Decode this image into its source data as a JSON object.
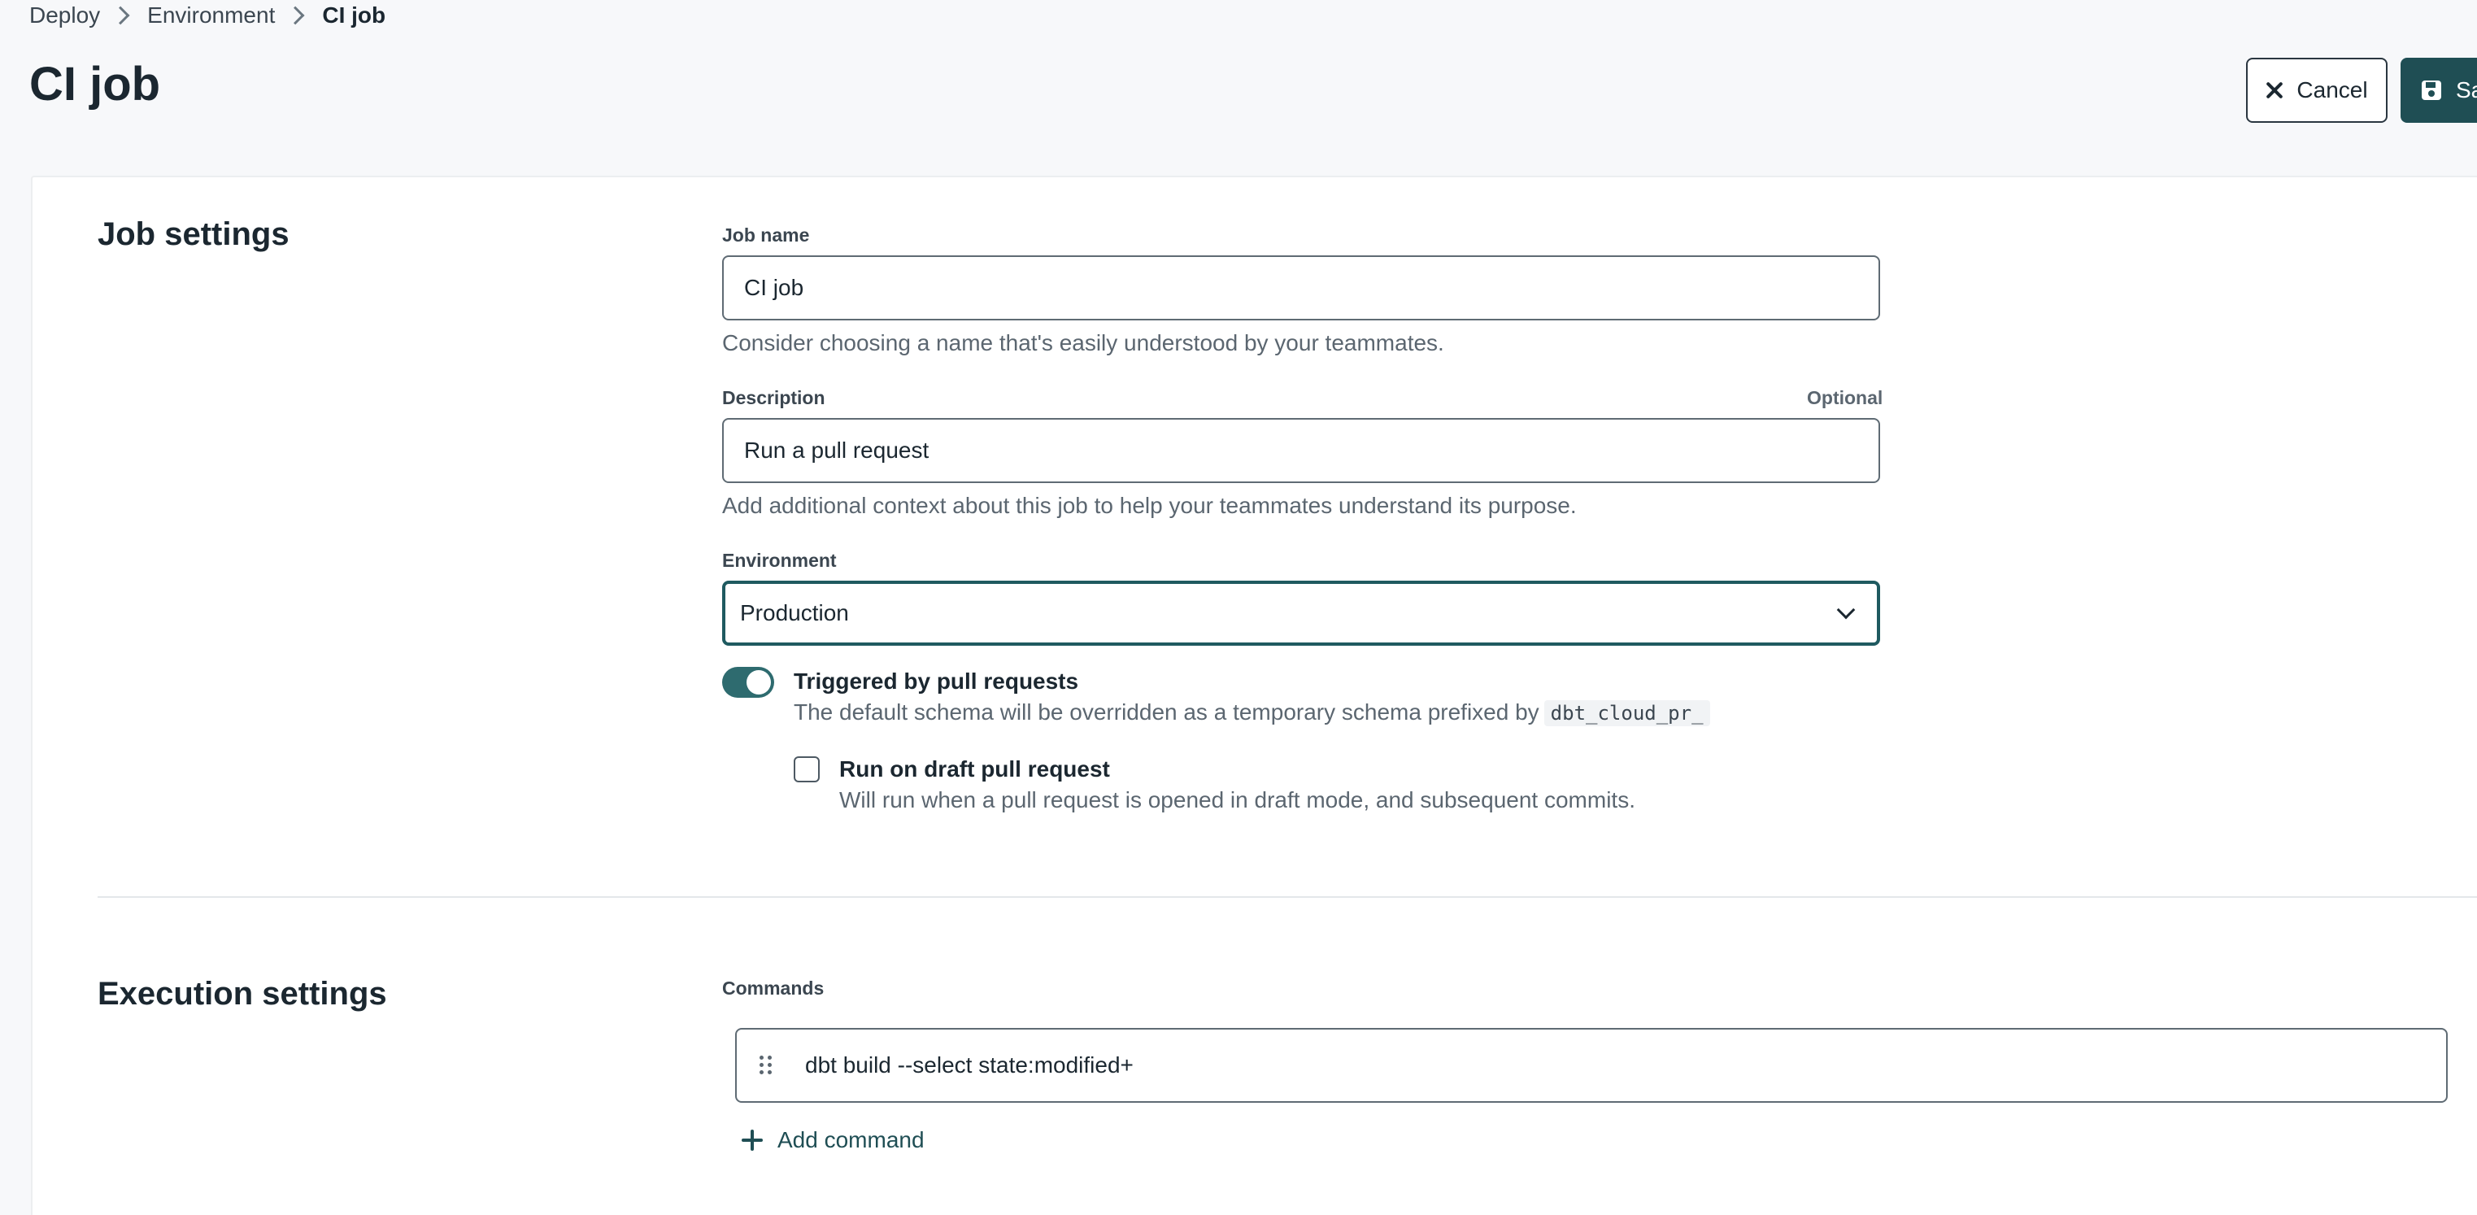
{
  "breadcrumb": {
    "items": [
      "Deploy",
      "Environment"
    ],
    "current": "CI job"
  },
  "page": {
    "title": "CI job"
  },
  "header": {
    "cancel_label": "Cancel",
    "save_label": "Sa"
  },
  "job_settings": {
    "title": "Job settings",
    "job_name": {
      "label": "Job name",
      "value": "CI job",
      "helper": "Consider choosing a name that's easily understood by your teammates."
    },
    "description": {
      "label": "Description",
      "optional": "Optional",
      "value": "Run a pull request",
      "helper": "Add additional context about this job to help your teammates understand its purpose."
    },
    "environment": {
      "label": "Environment",
      "value": "Production"
    },
    "trigger": {
      "enabled": true,
      "title": "Triggered by pull requests",
      "description": "The default schema will be overridden as a temporary schema prefixed by",
      "code": "dbt_cloud_pr_"
    },
    "draft": {
      "checked": false,
      "title": "Run on draft pull request",
      "description": "Will run when a pull request is opened in draft mode, and subsequent commits."
    }
  },
  "execution_settings": {
    "title": "Execution settings",
    "commands_label": "Commands",
    "commands": [
      "dbt build --select state:modified+"
    ],
    "add_command_label": "Add command"
  },
  "colors": {
    "primary": "#1f4e54",
    "toggle_on": "#2e6b6f",
    "select_focus": "#1f5a60"
  }
}
